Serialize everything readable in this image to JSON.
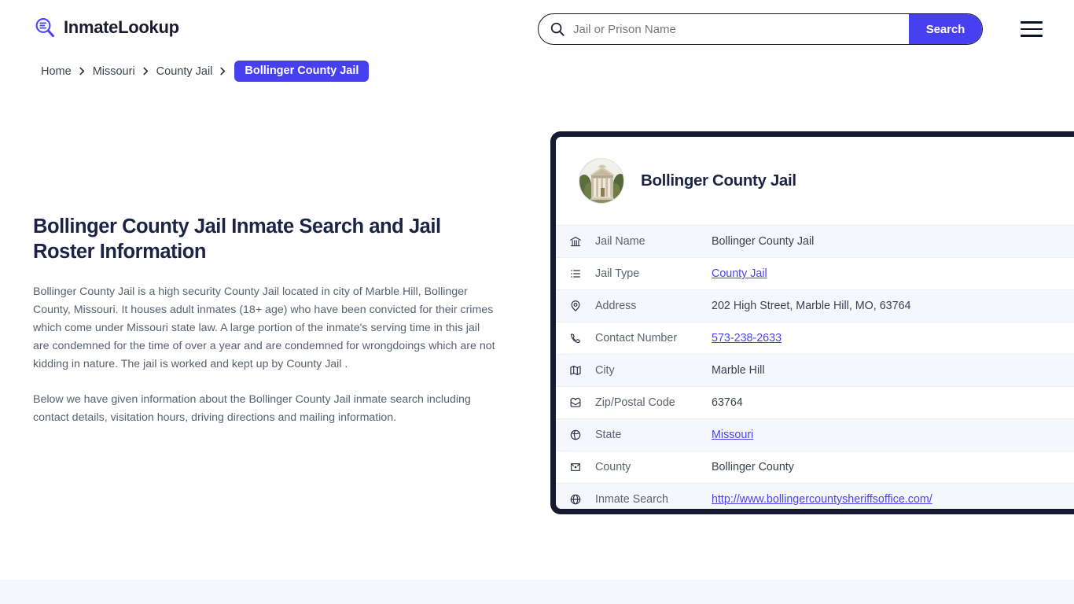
{
  "header": {
    "logo_text": "InmateLookup",
    "logo_icon": "search-document-icon",
    "menu_icon": "hamburger-menu-icon"
  },
  "search": {
    "placeholder": "Jail or Prison Name",
    "value": "",
    "button_label": "Search",
    "icon": "search-icon",
    "accent_color": "#4640f0"
  },
  "breadcrumb": {
    "items": [
      {
        "label": "Home"
      },
      {
        "label": "Missouri"
      },
      {
        "label": "County Jail"
      }
    ],
    "current": "Bollinger County Jail",
    "separator_icon": "chevron-right-icon"
  },
  "main": {
    "title": "Bollinger County Jail Inmate Search and Jail Roster Information",
    "paragraph1": "Bollinger County Jail is a high security County Jail located in city of Marble Hill, Bollinger County, Missouri. It houses adult inmates (18+ age) who have been convicted for their crimes which come under Missouri state law. A large portion of the inmate's serving time in this jail are condemned for the time of over a year and are condemned for wrongdoings which are not kidding in nature. The jail is worked and kept up by County Jail .",
    "paragraph2": "Below we have given information about the Bollinger County Jail inmate search including contact details, visitation hours, driving directions and mailing information."
  },
  "card": {
    "title": "Bollinger County Jail",
    "avatar_icon": "courthouse-photo",
    "border_color": "#141a30",
    "rows": [
      {
        "icon": "bank-icon",
        "label": "Jail Name",
        "value": "Bollinger County Jail",
        "link": false
      },
      {
        "icon": "list-icon",
        "label": "Jail Type",
        "value": "County Jail",
        "link": true
      },
      {
        "icon": "map-pin-icon",
        "label": "Address",
        "value": "202 High Street, Marble Hill, MO, 63764",
        "link": false
      },
      {
        "icon": "phone-icon",
        "label": "Contact Number",
        "value": "573-238-2633",
        "link": true
      },
      {
        "icon": "map-icon",
        "label": "City",
        "value": "Marble Hill",
        "link": false
      },
      {
        "icon": "envelope-icon",
        "label": "Zip/Postal Code",
        "value": "63764",
        "link": false
      },
      {
        "icon": "globe-pin-icon",
        "label": "State",
        "value": "Missouri",
        "link": true
      },
      {
        "icon": "county-icon",
        "label": "County",
        "value": "Bollinger County",
        "link": false
      },
      {
        "icon": "world-icon",
        "label": "Inmate Search",
        "value": "http://www.bollingercountysheriffsoffice.com/",
        "link": true
      }
    ]
  }
}
